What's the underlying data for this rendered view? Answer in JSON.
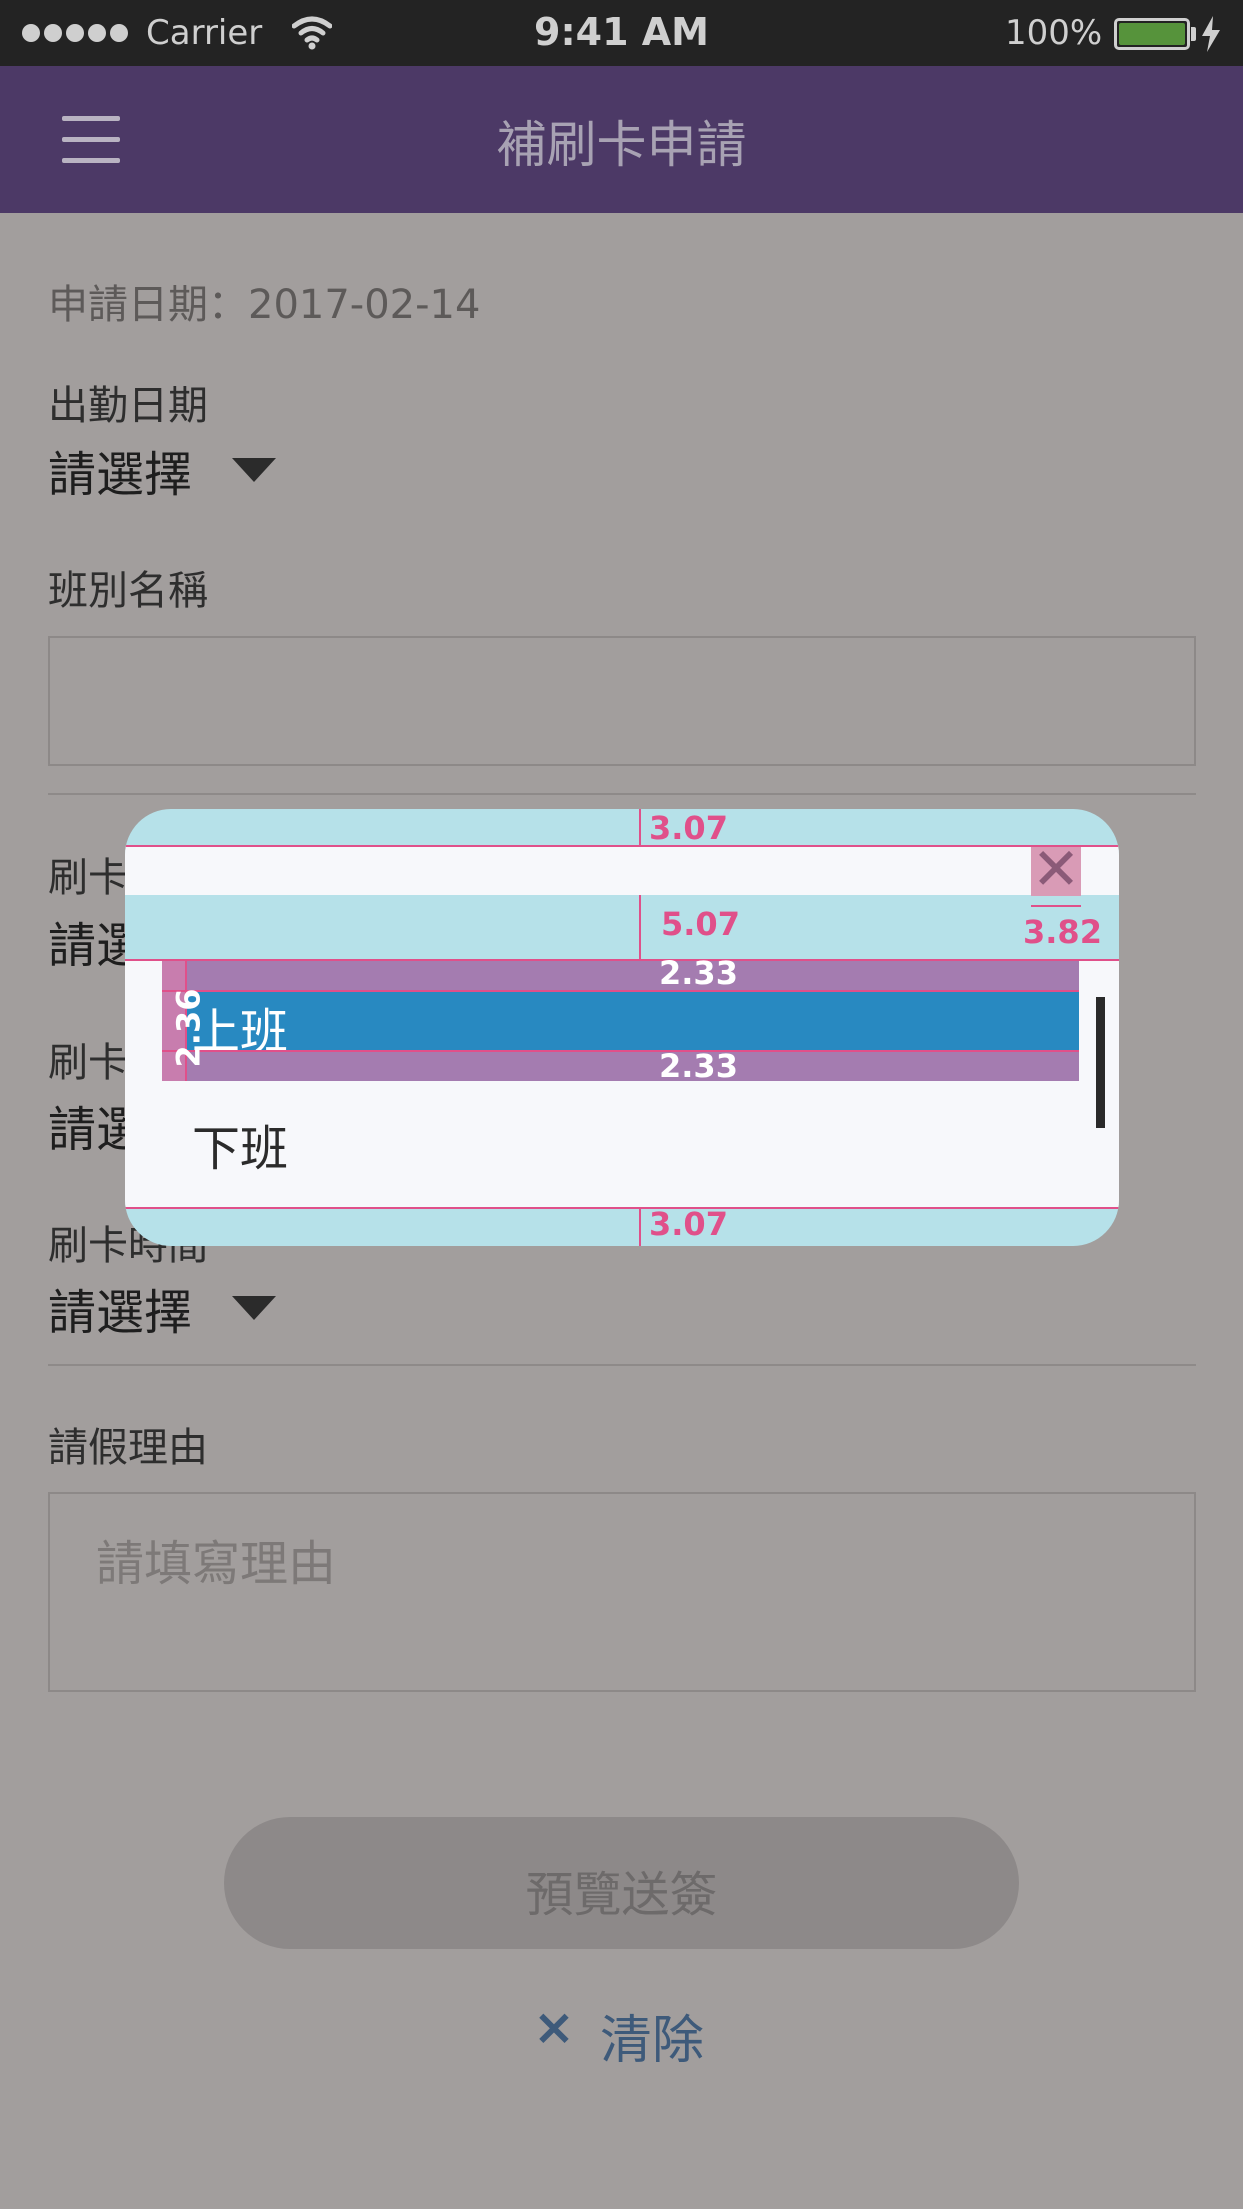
{
  "status_bar": {
    "carrier": "Carrier",
    "time": "9:41 AM",
    "battery": "100%",
    "battery_level": 1.0,
    "signal_dots": 5,
    "icons": [
      "signal-dots-icon",
      "wifi-icon",
      "battery-icon",
      "charging-bolt-icon"
    ]
  },
  "navbar": {
    "title": "補刷卡申請",
    "menu_icon": "hamburger-icon",
    "background": "#4c3966"
  },
  "form": {
    "apply_date": "申請日期：2017-02-14",
    "attendance_date": {
      "label": "出勤日期",
      "value": "請選擇"
    },
    "shift_name": {
      "label": "班別名稱",
      "value": ""
    },
    "punch_type": {
      "label_partial": "刷卡",
      "value_partial": "請選"
    },
    "punch_category": {
      "label_partial": "刷卡",
      "value_partial": "請選"
    },
    "punch_time": {
      "label_partial": "刷卡時間",
      "value": "請選擇"
    },
    "reason": {
      "label": "請假理由",
      "placeholder": "請填寫理由"
    }
  },
  "actions": {
    "preview_submit": "預覽送簽",
    "clear_icon": "×",
    "clear_label": "清除"
  },
  "modal": {
    "options": [
      {
        "label": "上班",
        "selected": true
      },
      {
        "label": "下班",
        "selected": false
      }
    ],
    "close_icon": "✕",
    "selected_color": "#2889c1",
    "annotations": {
      "top_padding": "3.07",
      "header_gap": "5.07",
      "close_size": "3.82",
      "band_top": "2.33",
      "band_bottom": "2.33",
      "side": "2.36",
      "bottom_padding": "3.07"
    }
  }
}
